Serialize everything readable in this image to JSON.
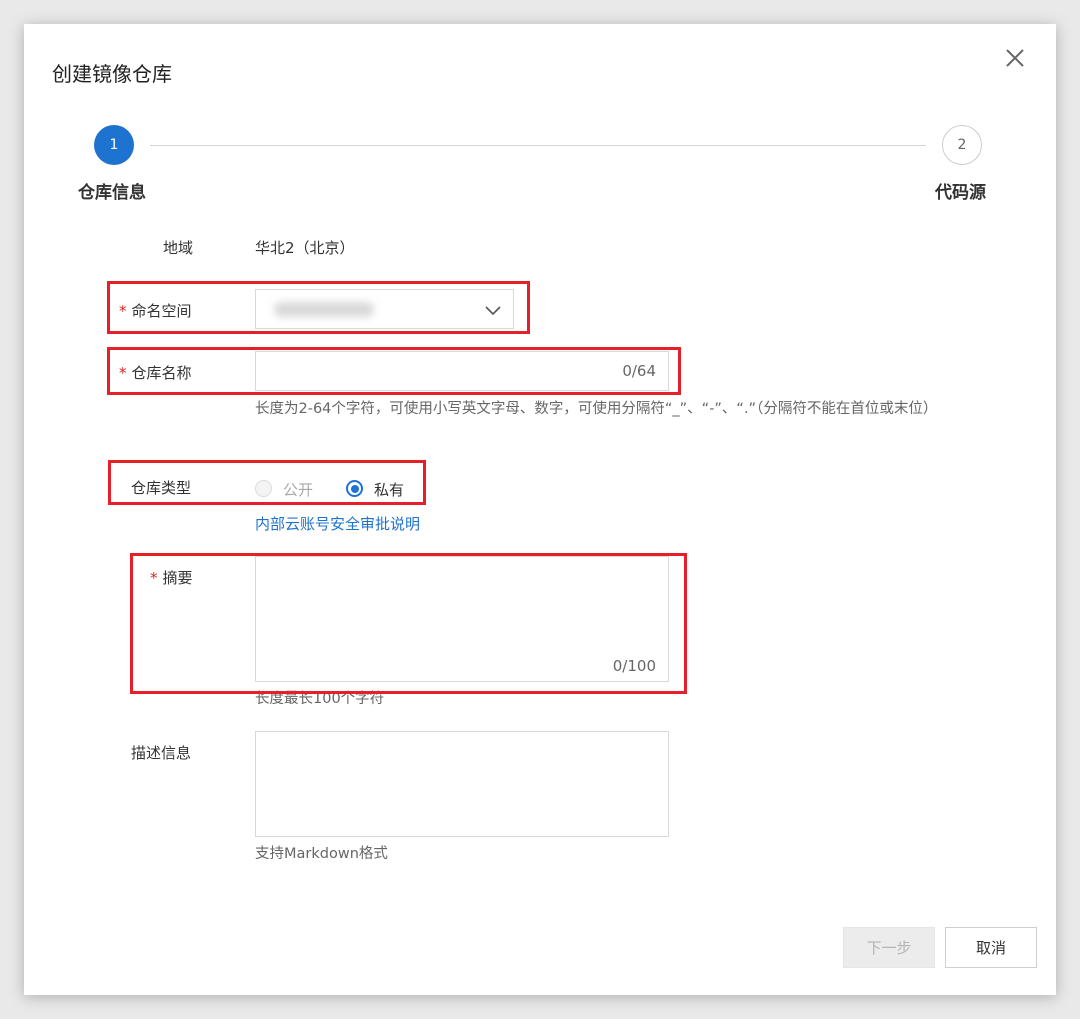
{
  "dialog": {
    "title": "创建镜像仓库",
    "close_icon": "close-icon"
  },
  "steps": [
    {
      "number": "1",
      "label": "仓库信息",
      "state": "active"
    },
    {
      "number": "2",
      "label": "代码源",
      "state": "inactive"
    }
  ],
  "form": {
    "region": {
      "label": "地域",
      "value": "华北2（北京）"
    },
    "namespace": {
      "required_mark": "*",
      "label": "命名空间",
      "value": "",
      "icon": "chevron-down-icon"
    },
    "repo_name": {
      "required_mark": "*",
      "label": "仓库名称",
      "value": "",
      "counter": "0/64",
      "help": "长度为2-64个字符，可使用小写英文字母、数字，可使用分隔符“_”、“-”、“.”（分隔符不能在首位或末位）"
    },
    "repo_type": {
      "label": "仓库类型",
      "options": [
        {
          "label": "公开",
          "checked": false,
          "disabled": true
        },
        {
          "label": "私有",
          "checked": true,
          "disabled": false
        }
      ],
      "link": "内部云账号安全审批说明"
    },
    "summary": {
      "required_mark": "*",
      "label": "摘要",
      "value": "",
      "counter": "0/100",
      "help": "长度最长100个字符"
    },
    "description": {
      "label": "描述信息",
      "value": "",
      "help": "支持Markdown格式"
    }
  },
  "footer": {
    "next_label": "下一步",
    "cancel_label": "取消"
  },
  "colors": {
    "accent": "#1e73d0",
    "required": "#e02020",
    "highlight": "#e6202a"
  }
}
